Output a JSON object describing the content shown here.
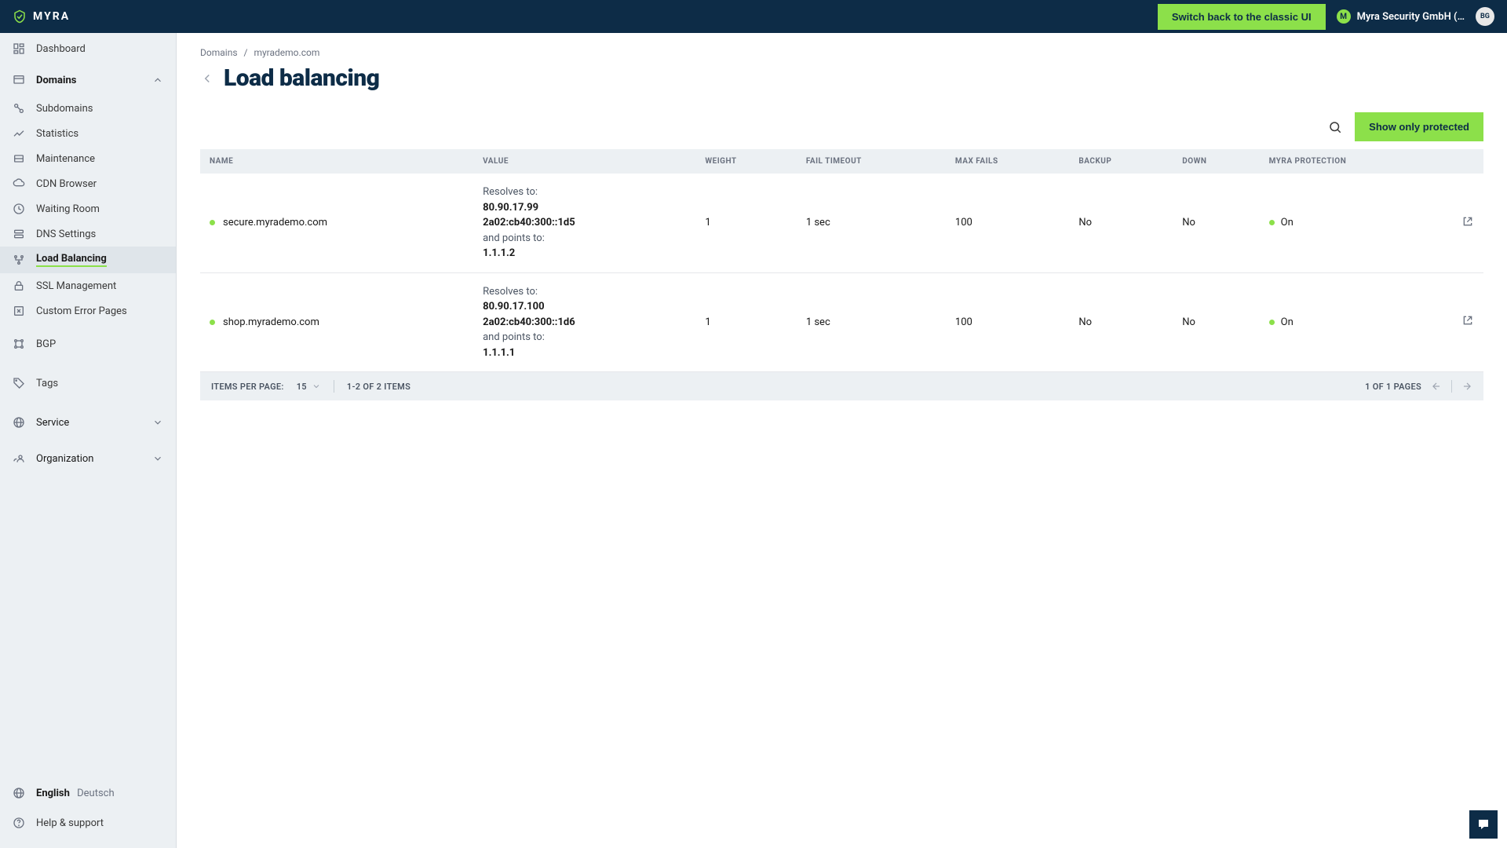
{
  "brand": "MYRA",
  "topbar": {
    "classic_btn": "Switch back to the classic UI",
    "org_name": "Myra Security GmbH (…",
    "avatar_initials": "BG"
  },
  "sidebar": {
    "dashboard": "Dashboard",
    "domains": "Domains",
    "subs": {
      "subdomains": "Subdomains",
      "statistics": "Statistics",
      "maintenance": "Maintenance",
      "cdn_browser": "CDN Browser",
      "waiting_room": "Waiting Room",
      "dns_settings": "DNS Settings",
      "load_balancing": "Load Balancing",
      "ssl_management": "SSL Management",
      "custom_error_pages": "Custom Error Pages"
    },
    "bgp": "BGP",
    "tags": "Tags",
    "service": "Service",
    "organization": "Organization",
    "lang_en": "English",
    "lang_de": "Deutsch",
    "help": "Help & support"
  },
  "breadcrumb": {
    "domains": "Domains",
    "sep": "/",
    "current": "myrademo.com"
  },
  "page_title": "Load balancing",
  "actions": {
    "show_protected": "Show only protected"
  },
  "table": {
    "headers": {
      "name": "NAME",
      "value": "VALUE",
      "weight": "WEIGHT",
      "fail_timeout": "FAIL TIMEOUT",
      "max_fails": "MAX FAILS",
      "backup": "BACKUP",
      "down": "DOWN",
      "protection": "MYRA PROTECTION"
    },
    "rows": [
      {
        "name": "secure.myrademo.com",
        "resolves_label": "Resolves to:",
        "ip1": "80.90.17.99",
        "ip2": "2a02:cb40:300::1d5",
        "points_label": "and points to:",
        "pointsto": "1.1.1.2",
        "weight": "1",
        "fail_timeout": "1 sec",
        "max_fails": "100",
        "backup": "No",
        "down": "No",
        "protection": "On"
      },
      {
        "name": "shop.myrademo.com",
        "resolves_label": "Resolves to:",
        "ip1": "80.90.17.100",
        "ip2": "2a02:cb40:300::1d6",
        "points_label": "and points to:",
        "pointsto": "1.1.1.1",
        "weight": "1",
        "fail_timeout": "1 sec",
        "max_fails": "100",
        "backup": "No",
        "down": "No",
        "protection": "On"
      }
    ]
  },
  "pagination": {
    "items_per_page_label": "ITEMS PER PAGE:",
    "items_per_page": "15",
    "range": "1-2 OF 2 ITEMS",
    "pages": "1 OF 1 PAGES"
  }
}
